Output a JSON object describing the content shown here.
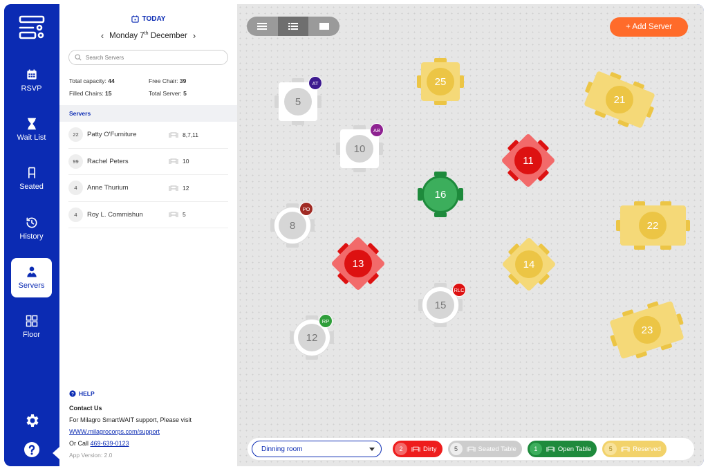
{
  "nav": {
    "items": [
      {
        "key": "rsvp",
        "label": "RSVP",
        "icon": "calendar-icon"
      },
      {
        "key": "wait",
        "label": "Wait List",
        "icon": "hourglass-icon"
      },
      {
        "key": "seated",
        "label": "Seated",
        "icon": "chair-icon"
      },
      {
        "key": "history",
        "label": "History",
        "icon": "history-icon"
      },
      {
        "key": "servers",
        "label": "Servers",
        "icon": "server-person-icon",
        "active": true
      },
      {
        "key": "floor",
        "label": "Floor",
        "icon": "grid-icon"
      }
    ],
    "settings_icon": "gear-icon",
    "help_icon": "help-icon"
  },
  "header": {
    "today": "TODAY",
    "weekday": "Monday",
    "day": "7",
    "day_suffix": "th",
    "month": "December",
    "search_placeholder": "Search Servers"
  },
  "stats": {
    "total_capacity_label": "Total capacity:",
    "total_capacity": "44",
    "free_chair_label": "Free Chair:",
    "free_chair": "39",
    "filled_chairs_label": "Filled Chairs:",
    "filled_chairs": "15",
    "total_server_label": "Total Server:",
    "total_server": "5"
  },
  "servers": {
    "heading": "Servers",
    "rows": [
      {
        "count": "22",
        "name": "Patty O'Furniture",
        "tables": "8,7,11"
      },
      {
        "count": "99",
        "name": "Rachel Peters",
        "tables": "10"
      },
      {
        "count": "4",
        "name": "Anne Thurium",
        "tables": "12"
      },
      {
        "count": "4",
        "name": "Roy L. Commishun",
        "tables": "5"
      }
    ]
  },
  "help": {
    "title": "HELP",
    "contact_title": "Contact Us",
    "support_text": "For Milagro SmartWAIT support, Please visit",
    "support_link": "WWW.milagrocorps.com/support",
    "call_prefix": "Or Call",
    "phone": "469-639-0123",
    "version": "App Version: 2.0"
  },
  "floor": {
    "add_server_label": "+ Add Server",
    "view_modes": [
      "list-compact-icon",
      "list-detail-icon",
      "card-view-icon"
    ],
    "active_view": 1,
    "colors": {
      "white": "#ffffff",
      "grey": "#d6d6d6",
      "yellow": "#f5d978",
      "yellow_dark": "#ecc545",
      "green": "#3cae5c",
      "green_dark": "#1e8a3c",
      "red": "#f26a6a",
      "red_dark": "#dd1111",
      "orange": "#ff6b2a",
      "navy": "#0b2bb3"
    },
    "tables": [
      {
        "num": "5",
        "status": "seated",
        "shape": "square",
        "badge": "AT",
        "badge_color": "#3d1a8f"
      },
      {
        "num": "10",
        "status": "seated",
        "shape": "square",
        "badge": "AB",
        "badge_color": "#8e2291"
      },
      {
        "num": "25",
        "status": "reserved",
        "shape": "square"
      },
      {
        "num": "21",
        "status": "reserved",
        "shape": "rect"
      },
      {
        "num": "11",
        "status": "dirty",
        "shape": "square"
      },
      {
        "num": "16",
        "status": "open",
        "shape": "round"
      },
      {
        "num": "8",
        "status": "seated",
        "shape": "round",
        "badge": "PO",
        "badge_color": "#a02b24"
      },
      {
        "num": "22",
        "status": "reserved",
        "shape": "rect"
      },
      {
        "num": "13",
        "status": "dirty",
        "shape": "square"
      },
      {
        "num": "14",
        "status": "reserved",
        "shape": "square"
      },
      {
        "num": "15",
        "status": "seated",
        "shape": "round",
        "badge": "RLC",
        "badge_color": "#dd1111"
      },
      {
        "num": "12",
        "status": "seated",
        "shape": "round",
        "badge": "RP",
        "badge_color": "#2f9e3a"
      },
      {
        "num": "23",
        "status": "reserved",
        "shape": "rect"
      }
    ]
  },
  "legend": {
    "room": "Dinning room",
    "chips": [
      {
        "count": "2",
        "label": "Dirty",
        "status": "dirty"
      },
      {
        "count": "5",
        "label": "Seated Table",
        "status": "seated"
      },
      {
        "count": "1",
        "label": "Open Table",
        "status": "open"
      },
      {
        "count": "5",
        "label": "Reserved",
        "status": "reserved"
      }
    ]
  }
}
